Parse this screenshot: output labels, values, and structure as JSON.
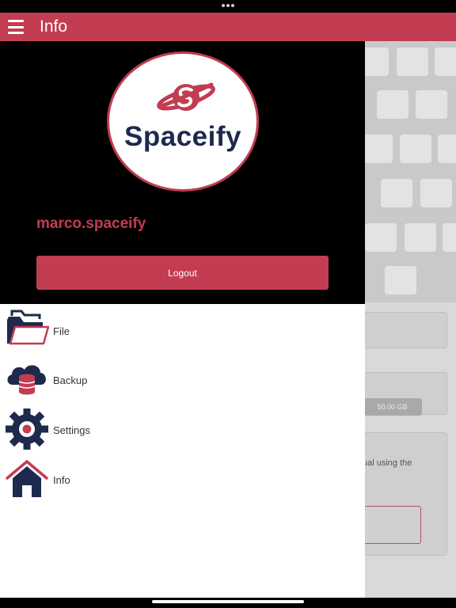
{
  "app_bar": {
    "title": "Info"
  },
  "drawer": {
    "logo_text": "Spaceify",
    "username": "marco.spaceify",
    "logout_label": "Logout",
    "menu": [
      {
        "label": "File",
        "icon": "folder-icon"
      },
      {
        "label": "Backup",
        "icon": "cloud-database-icon"
      },
      {
        "label": "Settings",
        "icon": "gear-icon"
      },
      {
        "label": "Info",
        "icon": "home-icon"
      }
    ]
  },
  "background": {
    "storage_value": "50.00 GB",
    "manual_text": "ual using the"
  },
  "colors": {
    "accent": "#c23c52",
    "navy": "#1d2a4e"
  }
}
